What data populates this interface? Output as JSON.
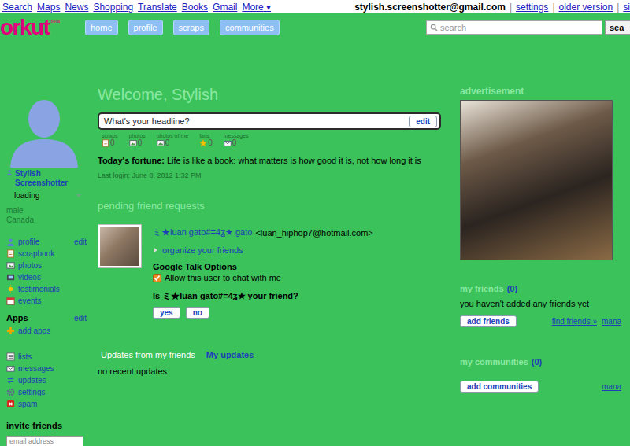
{
  "topbar": {
    "links": [
      "Search",
      "Maps",
      "News",
      "Shopping",
      "Translate",
      "Books",
      "Gmail"
    ],
    "more": "More",
    "more_arrow": "▾",
    "account": "stylish.screenshotter@gmail.com",
    "separator": "|",
    "account_links": [
      "settings",
      "older version",
      "si"
    ]
  },
  "header": {
    "logo": "orkut",
    "logo_badge": "beta",
    "nav": [
      {
        "label": "home",
        "selected": false
      },
      {
        "label": "profile",
        "selected": false
      },
      {
        "label": "scraps",
        "selected": false
      },
      {
        "label": "communities",
        "selected": false
      }
    ],
    "search": {
      "placeholder": "search",
      "button": "sea"
    }
  },
  "profile": {
    "name": "Stylish Screenshotter",
    "status": "loading",
    "gender": "male",
    "country": "Canada"
  },
  "sidebar": {
    "items": [
      {
        "label": "profile",
        "action": "edit"
      },
      {
        "label": "scrapbook",
        "action": ""
      },
      {
        "label": "photos",
        "action": ""
      },
      {
        "label": "videos",
        "action": ""
      },
      {
        "label": "testimonials",
        "action": ""
      },
      {
        "label": "events",
        "action": ""
      }
    ],
    "apps": {
      "title": "Apps",
      "action": "edit",
      "items": [
        "add apps"
      ]
    },
    "tools": [
      "lists",
      "messages",
      "updates",
      "settings",
      "spam"
    ],
    "invite": {
      "title": "invite friends",
      "placeholder": "email address"
    }
  },
  "welcome": "Welcome, Stylish",
  "headline": {
    "placeholder": "What's your headline?",
    "button": "edit"
  },
  "stats": [
    {
      "label": "scraps",
      "count": "0"
    },
    {
      "label": "photos",
      "count": "0"
    },
    {
      "label": "photos of me",
      "count": "0"
    },
    {
      "label": "fans",
      "count": "0"
    },
    {
      "label": "messages",
      "count": "0"
    }
  ],
  "fortune": {
    "label": "Today's fortune:",
    "text": "Life is like a book: what matters is how good it is, not how long it is"
  },
  "last_login": "Last login: June 8, 2012 1:32 PM",
  "requests": {
    "title": "pending friend requests",
    "items": [
      {
        "name": "ミ★luan gato#=4ʓ★ gato",
        "email": "<luan_hiphop7@hotmail.com>",
        "organize": "organize your friends",
        "talk_title": "Google Talk Options",
        "talk_option": {
          "label": "Allow this user to chat with me",
          "checked": true
        },
        "question": "Is ミ★luan gato#=4ʓ★ your friend?",
        "buttons": [
          "yes",
          "no"
        ]
      }
    ]
  },
  "updates": {
    "tabs": [
      {
        "label": "Updates from my friends",
        "selected": true
      },
      {
        "label": "My updates",
        "selected": false
      }
    ],
    "empty": "no recent updates"
  },
  "ads": {
    "title": "advertisement"
  },
  "friends": {
    "title": "my friends",
    "count": "(0)",
    "empty": "you haven't added any friends yet",
    "button": "add friends",
    "link": "find friends »",
    "manage": "mana"
  },
  "communities": {
    "title": "my communities",
    "count": "(0)",
    "button": "add communities",
    "manage": "mana"
  }
}
